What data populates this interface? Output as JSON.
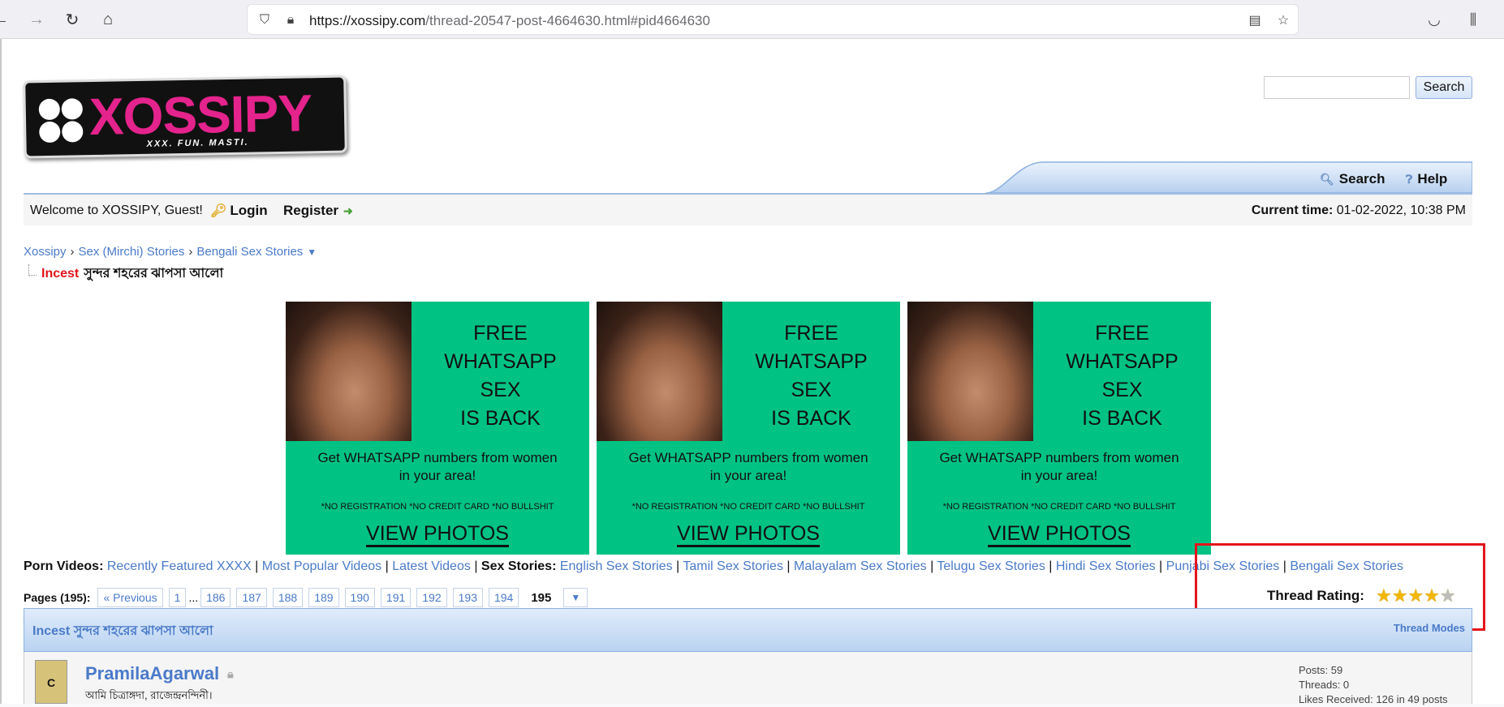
{
  "browser": {
    "url_host": "https://xossipy.com",
    "url_path": "/thread-20547-post-4664630.html#pid4664630",
    "icons": {
      "back": "arrow-left-icon",
      "forward": "arrow-right-icon",
      "reload": "reload-icon",
      "home": "home-icon",
      "shield": "shield-icon",
      "lock": "lock-icon",
      "reader": "reader-view-icon",
      "bookmark": "star-icon",
      "pocket": "pocket-icon",
      "library": "library-icon"
    }
  },
  "logo": {
    "word": "XOSSIPY",
    "tagline": "XXX. FUN. MASTI.",
    "brand_color": "#e4238c"
  },
  "search": {
    "button_label": "Search"
  },
  "menu": {
    "search_label": "Search",
    "help_label": "Help"
  },
  "welcome": {
    "text": "Welcome to XOSSIPY, Guest!",
    "login_label": "Login",
    "register_label": "Register",
    "time_label": "Current time:",
    "time_value": "01-02-2022, 10:38 PM"
  },
  "breadcrumb": {
    "items": [
      "Xossipy",
      "Sex (Mirchi) Stories",
      "Bengali Sex Stories"
    ],
    "thread_prefix": "Incest",
    "thread_title": "সুন্দর শহরের ঝাপসা আলো"
  },
  "ads": {
    "headline_1": "FREE",
    "headline_2": "WHATSAPP",
    "headline_3": "SEX",
    "headline_4": "IS BACK",
    "sub_1": "Get WHATSAPP numbers from women",
    "sub_2": "in your area!",
    "small": "*NO REGISTRATION *NO CREDIT CARD *NO BULLSHIT",
    "cta": "VIEW PHOTOS",
    "bg_color": "#00c383"
  },
  "links": {
    "porn_label": "Porn Videos:",
    "porn_links": [
      "Recently Featured XXXX",
      "Most Popular Videos",
      "Latest Videos"
    ],
    "stories_label": "Sex Stories:",
    "story_links": [
      "English Sex Stories",
      "Tamil Sex Stories",
      "Malayalam Sex Stories",
      "Telugu Sex Stories",
      "Hindi Sex Stories",
      "Punjabi Sex Stories",
      "Bengali Sex Stories"
    ],
    "separator": "|"
  },
  "pagination": {
    "label": "Pages (195):",
    "previous": "« Previous",
    "first": "1",
    "ellipsis": "...",
    "pages": [
      "186",
      "187",
      "188",
      "189",
      "190",
      "191",
      "192",
      "193",
      "194"
    ],
    "current": "195"
  },
  "rating": {
    "label": "Thread Rating:",
    "stars_filled": 4,
    "stars_total": 5
  },
  "thread_header": {
    "prefix": "Incest",
    "title": "সুন্দর শহরের ঝাপসা আলো",
    "modes_label": "Thread Modes"
  },
  "post": {
    "username": "PramilaAgarwal",
    "user_title": "আমি চিত্রাঙ্গদা, রাজেন্দ্রনন্দিনী।",
    "avatar_letter": "C",
    "stats_posts": "Posts: 59",
    "stats_threads": "Threads: 0",
    "stats_likes": "Likes Received: 126 in 49 posts"
  }
}
